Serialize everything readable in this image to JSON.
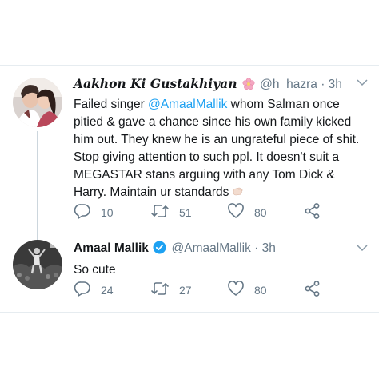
{
  "tweets": [
    {
      "name": "Aakhon Ki Gustakhiyan",
      "handle": "@h_hazra",
      "separator": "·",
      "time": "3h",
      "text_prefix": "Failed singer ",
      "mention": "@AmaalMallik",
      "text_suffix": " whom Salman once pitied & gave a chance since his own family kicked him out. They knew he is an ungrateful piece of shit. Stop giving attention to such ppl. It doesn't suit a MEGASTAR stans arguing with any Tom Dick & Harry. Maintain ur standards",
      "counts": {
        "replies": "10",
        "retweets": "51",
        "likes": "80"
      }
    },
    {
      "name": "Amaal Mallik",
      "handle": "@AmaalMallik",
      "separator": "·",
      "time": "3h",
      "text": "So cute",
      "counts": {
        "replies": "24",
        "retweets": "27",
        "likes": "80"
      }
    }
  ],
  "icons": {
    "reply": "reply-icon",
    "retweet": "retweet-icon",
    "like": "heart-icon",
    "share": "share-icon",
    "menu": "chevron-down-icon",
    "verified": "verified-badge-icon",
    "name_emoji": "cherry-blossom-icon",
    "text_emoji": "hand-emoji-icon"
  },
  "colors": {
    "link": "#1da1f2",
    "secondary_text": "#657786",
    "verified": "#1da1f2",
    "divider": "#e6ecf0"
  }
}
